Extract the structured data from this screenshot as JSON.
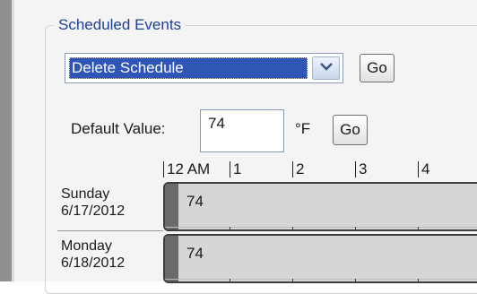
{
  "group": {
    "title": "Scheduled Events"
  },
  "schedule_combo": {
    "value": "Delete Schedule",
    "icon": "chevron-down-icon"
  },
  "go_button_1": {
    "label": "Go"
  },
  "default_value": {
    "label": "Default Value:",
    "value": "74",
    "unit": "°F"
  },
  "go_button_2": {
    "label": "Go"
  },
  "timeline": {
    "hours": [
      "12 AM",
      "1",
      "2",
      "3",
      "4"
    ]
  },
  "rows": [
    {
      "day": "Sunday",
      "date": "6/17/2012",
      "value": "74"
    },
    {
      "day": "Monday",
      "date": "6/18/2012",
      "value": "74"
    }
  ],
  "colors": {
    "accent_title": "#1e3f9a",
    "selection": "#2f55b6",
    "schedule_bar": "#d6d6d6",
    "schedule_handle": "#6a6a6a"
  }
}
